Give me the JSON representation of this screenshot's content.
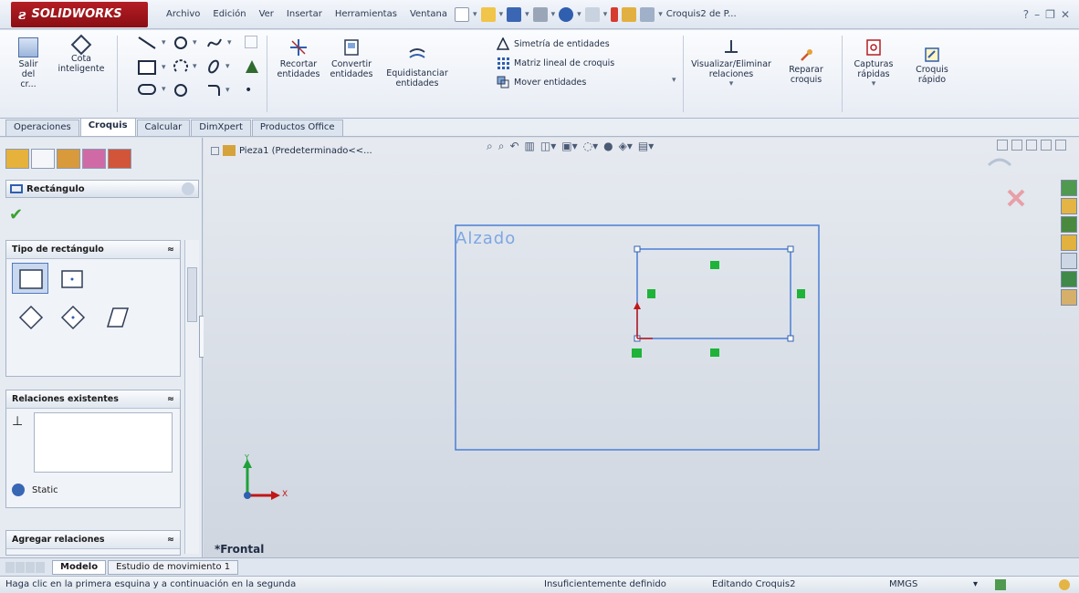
{
  "app": {
    "logo": "SOLIDWORKS",
    "doc_title": "Croquis2 de P..."
  },
  "menu": [
    "Archivo",
    "Edición",
    "Ver",
    "Insertar",
    "Herramientas",
    "Ventana"
  ],
  "ribbon": {
    "exit_sketch": [
      "Salir",
      "del cr..."
    ],
    "smart_dim": [
      "Cota",
      "inteligente"
    ],
    "trim": [
      "Recortar",
      "entidades"
    ],
    "convert": [
      "Convertir",
      "entidades"
    ],
    "offset": [
      "Equidistanciar",
      "entidades"
    ],
    "mirror": "Simetría de entidades",
    "linear_pattern": "Matriz lineal de croquis",
    "move": "Mover entidades",
    "relations": [
      "Visualizar/Eliminar",
      "relaciones"
    ],
    "repair": [
      "Reparar",
      "croquis"
    ],
    "quick_snaps": [
      "Capturas",
      "rápidas"
    ],
    "rapid_sketch": [
      "Croquis",
      "rápido"
    ]
  },
  "tabs": [
    "Operaciones",
    "Croquis",
    "Calcular",
    "DimXpert",
    "Productos Office"
  ],
  "active_tab": "Croquis",
  "panel": {
    "title": "Rectángulo",
    "group_type": "Tipo de rectángulo",
    "group_relations": "Relaciones existentes",
    "status_label": "Static",
    "group_add": "Agregar relaciones"
  },
  "tree": {
    "label": "Pieza1  (Predeterminado<<..."
  },
  "canvas": {
    "plane_label": "Alzado",
    "view_name": "*Frontal",
    "axis_x": "X",
    "axis_y": "Y"
  },
  "bottom_tabs": [
    "Modelo",
    "Estudio de movimiento 1"
  ],
  "status": {
    "hint": "Haga clic en la primera esquina y a continuación en la segunda",
    "definition": "Insuficientemente definido",
    "editing": "Editando Croquis2",
    "units": "MMGS"
  },
  "colors": {
    "accent_red": "#b51d24",
    "sketch_blue": "#4a7fd4",
    "relation_green": "#1fb33a",
    "check_green": "#3da030"
  }
}
